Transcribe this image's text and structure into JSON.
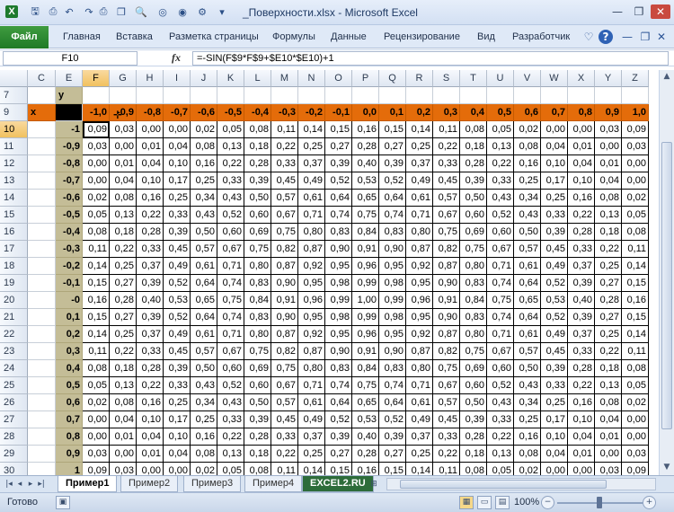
{
  "window": {
    "title": "_Поверхности.xlsx - Microsoft Excel",
    "minimize": "—",
    "restore": "❐",
    "close": "✕"
  },
  "quick_access": [
    {
      "name": "excel-logo-icon",
      "glyph": "X"
    },
    {
      "name": "save-icon",
      "glyph": "🖫"
    },
    {
      "name": "print-preview-icon",
      "glyph": "⎙"
    },
    {
      "name": "undo-icon",
      "glyph": "↶"
    },
    {
      "name": "redo-icon",
      "glyph": "↷"
    },
    {
      "name": "print-icon",
      "glyph": "⎙"
    },
    {
      "name": "copy-icon",
      "glyph": "❐"
    },
    {
      "name": "preview-icon",
      "glyph": "🔍"
    },
    {
      "name": "circle-icon",
      "glyph": "◎"
    },
    {
      "name": "record-icon",
      "glyph": "◉"
    },
    {
      "name": "settings-icon",
      "glyph": "⚙"
    },
    {
      "name": "qat-menu-icon",
      "glyph": "▾"
    }
  ],
  "ribbon": {
    "file": "Файл",
    "tabs": [
      "Главная",
      "Вставка",
      "Разметка страницы",
      "Формулы",
      "Данные",
      "Рецензирование",
      "Вид",
      "Разработчик"
    ],
    "icons": [
      {
        "name": "minimize-ribbon-icon",
        "glyph": "♡"
      },
      {
        "name": "help-icon",
        "glyph": "?"
      },
      {
        "name": "ribbon-minimize-icon",
        "glyph": "—"
      },
      {
        "name": "ribbon-restore-icon",
        "glyph": "❐"
      },
      {
        "name": "ribbon-close-icon",
        "glyph": "✕"
      }
    ]
  },
  "formula_bar": {
    "name_box": "F10",
    "fx": "fx",
    "formula": "=-SIN(F$9*F$9+$E10*$E10)+1"
  },
  "columns": [
    "C",
    "E",
    "F",
    "G",
    "H",
    "I",
    "J",
    "K",
    "L",
    "M",
    "N",
    "O",
    "P",
    "Q",
    "R",
    "S",
    "T",
    "U",
    "V",
    "W",
    "X",
    "Y",
    "Z"
  ],
  "selected_column": "F",
  "rows": [
    "7",
    "9",
    "10",
    "11",
    "12",
    "13",
    "14",
    "15",
    "16",
    "17",
    "18",
    "19",
    "20",
    "21",
    "22",
    "23",
    "24",
    "25",
    "26",
    "27",
    "28",
    "29",
    "30"
  ],
  "selected_row": "10",
  "labels": {
    "y": "y",
    "x": "x"
  },
  "x_values": [
    "-1,0",
    "-0,9",
    "-0,8",
    "-0,7",
    "-0,6",
    "-0,5",
    "-0,4",
    "-0,3",
    "-0,2",
    "-0,1",
    "0,0",
    "0,1",
    "0,2",
    "0,3",
    "0,4",
    "0,5",
    "0,6",
    "0,7",
    "0,8",
    "0,9",
    "1,0"
  ],
  "y_values": [
    "-1",
    "-0,9",
    "-0,8",
    "-0,7",
    "-0,6",
    "-0,5",
    "-0,4",
    "-0,3",
    "-0,2",
    "-0,1",
    "-0",
    "0,1",
    "0,2",
    "0,3",
    "0,4",
    "0,5",
    "0,6",
    "0,7",
    "0,8",
    "0,9",
    "1"
  ],
  "table": [
    [
      "0,09",
      "0,03",
      "0,00",
      "0,00",
      "0,02",
      "0,05",
      "0,08",
      "0,11",
      "0,14",
      "0,15",
      "0,16",
      "0,15",
      "0,14",
      "0,11",
      "0,08",
      "0,05",
      "0,02",
      "0,00",
      "0,00",
      "0,03",
      "0,09"
    ],
    [
      "0,03",
      "0,00",
      "0,01",
      "0,04",
      "0,08",
      "0,13",
      "0,18",
      "0,22",
      "0,25",
      "0,27",
      "0,28",
      "0,27",
      "0,25",
      "0,22",
      "0,18",
      "0,13",
      "0,08",
      "0,04",
      "0,01",
      "0,00",
      "0,03"
    ],
    [
      "0,00",
      "0,01",
      "0,04",
      "0,10",
      "0,16",
      "0,22",
      "0,28",
      "0,33",
      "0,37",
      "0,39",
      "0,40",
      "0,39",
      "0,37",
      "0,33",
      "0,28",
      "0,22",
      "0,16",
      "0,10",
      "0,04",
      "0,01",
      "0,00"
    ],
    [
      "0,00",
      "0,04",
      "0,10",
      "0,17",
      "0,25",
      "0,33",
      "0,39",
      "0,45",
      "0,49",
      "0,52",
      "0,53",
      "0,52",
      "0,49",
      "0,45",
      "0,39",
      "0,33",
      "0,25",
      "0,17",
      "0,10",
      "0,04",
      "0,00"
    ],
    [
      "0,02",
      "0,08",
      "0,16",
      "0,25",
      "0,34",
      "0,43",
      "0,50",
      "0,57",
      "0,61",
      "0,64",
      "0,65",
      "0,64",
      "0,61",
      "0,57",
      "0,50",
      "0,43",
      "0,34",
      "0,25",
      "0,16",
      "0,08",
      "0,02"
    ],
    [
      "0,05",
      "0,13",
      "0,22",
      "0,33",
      "0,43",
      "0,52",
      "0,60",
      "0,67",
      "0,71",
      "0,74",
      "0,75",
      "0,74",
      "0,71",
      "0,67",
      "0,60",
      "0,52",
      "0,43",
      "0,33",
      "0,22",
      "0,13",
      "0,05"
    ],
    [
      "0,08",
      "0,18",
      "0,28",
      "0,39",
      "0,50",
      "0,60",
      "0,69",
      "0,75",
      "0,80",
      "0,83",
      "0,84",
      "0,83",
      "0,80",
      "0,75",
      "0,69",
      "0,60",
      "0,50",
      "0,39",
      "0,28",
      "0,18",
      "0,08"
    ],
    [
      "0,11",
      "0,22",
      "0,33",
      "0,45",
      "0,57",
      "0,67",
      "0,75",
      "0,82",
      "0,87",
      "0,90",
      "0,91",
      "0,90",
      "0,87",
      "0,82",
      "0,75",
      "0,67",
      "0,57",
      "0,45",
      "0,33",
      "0,22",
      "0,11"
    ],
    [
      "0,14",
      "0,25",
      "0,37",
      "0,49",
      "0,61",
      "0,71",
      "0,80",
      "0,87",
      "0,92",
      "0,95",
      "0,96",
      "0,95",
      "0,92",
      "0,87",
      "0,80",
      "0,71",
      "0,61",
      "0,49",
      "0,37",
      "0,25",
      "0,14"
    ],
    [
      "0,15",
      "0,27",
      "0,39",
      "0,52",
      "0,64",
      "0,74",
      "0,83",
      "0,90",
      "0,95",
      "0,98",
      "0,99",
      "0,98",
      "0,95",
      "0,90",
      "0,83",
      "0,74",
      "0,64",
      "0,52",
      "0,39",
      "0,27",
      "0,15"
    ],
    [
      "0,16",
      "0,28",
      "0,40",
      "0,53",
      "0,65",
      "0,75",
      "0,84",
      "0,91",
      "0,96",
      "0,99",
      "1,00",
      "0,99",
      "0,96",
      "0,91",
      "0,84",
      "0,75",
      "0,65",
      "0,53",
      "0,40",
      "0,28",
      "0,16"
    ],
    [
      "0,15",
      "0,27",
      "0,39",
      "0,52",
      "0,64",
      "0,74",
      "0,83",
      "0,90",
      "0,95",
      "0,98",
      "0,99",
      "0,98",
      "0,95",
      "0,90",
      "0,83",
      "0,74",
      "0,64",
      "0,52",
      "0,39",
      "0,27",
      "0,15"
    ],
    [
      "0,14",
      "0,25",
      "0,37",
      "0,49",
      "0,61",
      "0,71",
      "0,80",
      "0,87",
      "0,92",
      "0,95",
      "0,96",
      "0,95",
      "0,92",
      "0,87",
      "0,80",
      "0,71",
      "0,61",
      "0,49",
      "0,37",
      "0,25",
      "0,14"
    ],
    [
      "0,11",
      "0,22",
      "0,33",
      "0,45",
      "0,57",
      "0,67",
      "0,75",
      "0,82",
      "0,87",
      "0,90",
      "0,91",
      "0,90",
      "0,87",
      "0,82",
      "0,75",
      "0,67",
      "0,57",
      "0,45",
      "0,33",
      "0,22",
      "0,11"
    ],
    [
      "0,08",
      "0,18",
      "0,28",
      "0,39",
      "0,50",
      "0,60",
      "0,69",
      "0,75",
      "0,80",
      "0,83",
      "0,84",
      "0,83",
      "0,80",
      "0,75",
      "0,69",
      "0,60",
      "0,50",
      "0,39",
      "0,28",
      "0,18",
      "0,08"
    ],
    [
      "0,05",
      "0,13",
      "0,22",
      "0,33",
      "0,43",
      "0,52",
      "0,60",
      "0,67",
      "0,71",
      "0,74",
      "0,75",
      "0,74",
      "0,71",
      "0,67",
      "0,60",
      "0,52",
      "0,43",
      "0,33",
      "0,22",
      "0,13",
      "0,05"
    ],
    [
      "0,02",
      "0,08",
      "0,16",
      "0,25",
      "0,34",
      "0,43",
      "0,50",
      "0,57",
      "0,61",
      "0,64",
      "0,65",
      "0,64",
      "0,61",
      "0,57",
      "0,50",
      "0,43",
      "0,34",
      "0,25",
      "0,16",
      "0,08",
      "0,02"
    ],
    [
      "0,00",
      "0,04",
      "0,10",
      "0,17",
      "0,25",
      "0,33",
      "0,39",
      "0,45",
      "0,49",
      "0,52",
      "0,53",
      "0,52",
      "0,49",
      "0,45",
      "0,39",
      "0,33",
      "0,25",
      "0,17",
      "0,10",
      "0,04",
      "0,00"
    ],
    [
      "0,00",
      "0,01",
      "0,04",
      "0,10",
      "0,16",
      "0,22",
      "0,28",
      "0,33",
      "0,37",
      "0,39",
      "0,40",
      "0,39",
      "0,37",
      "0,33",
      "0,28",
      "0,22",
      "0,16",
      "0,10",
      "0,04",
      "0,01",
      "0,00"
    ],
    [
      "0,03",
      "0,00",
      "0,01",
      "0,04",
      "0,08",
      "0,13",
      "0,18",
      "0,22",
      "0,25",
      "0,27",
      "0,28",
      "0,27",
      "0,25",
      "0,22",
      "0,18",
      "0,13",
      "0,08",
      "0,04",
      "0,01",
      "0,00",
      "0,03"
    ],
    [
      "0,09",
      "0,03",
      "0,00",
      "0,00",
      "0,02",
      "0,05",
      "0,08",
      "0,11",
      "0,14",
      "0,15",
      "0,16",
      "0,15",
      "0,14",
      "0,11",
      "0,08",
      "0,05",
      "0,02",
      "0,00",
      "0,00",
      "0,03",
      "0,09"
    ]
  ],
  "sheet_tabs": [
    "Пример1",
    "Пример2",
    "Пример3",
    "Пример4",
    "EXCEL2.RU"
  ],
  "active_tab": "Пример1",
  "tab_nav": [
    "|◂",
    "◂",
    "▸",
    "▸|"
  ],
  "status": {
    "ready": "Готово",
    "zoom": "100%",
    "zoom_out": "−",
    "zoom_in": "+"
  },
  "view_buttons": [
    {
      "name": "normal-view-icon",
      "glyph": "▦"
    },
    {
      "name": "page-layout-icon",
      "glyph": "▭"
    },
    {
      "name": "page-break-icon",
      "glyph": "▤"
    }
  ],
  "colors": {
    "header_orange": "#e46c0a",
    "header_tan": "#c4bd97",
    "selected_header": "#f4c76a",
    "file_tab": "#2a8a31"
  }
}
